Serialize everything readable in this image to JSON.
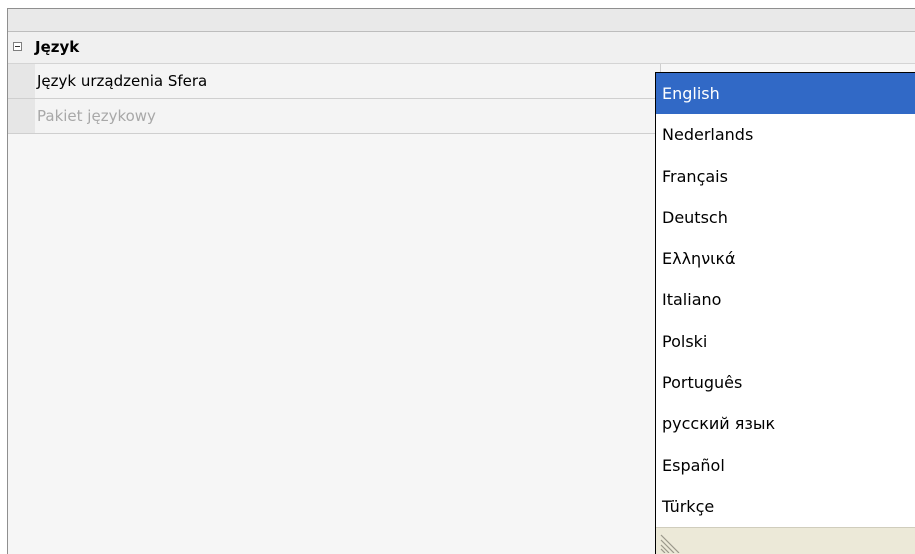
{
  "category": {
    "label": "Język",
    "expanded": true
  },
  "properties": [
    {
      "name": "Język urządzenia Sfera",
      "enabled": true
    },
    {
      "name": "Pakiet językowy",
      "enabled": false
    }
  ],
  "dropdown": {
    "selected": "English",
    "options": [
      "English",
      "Nederlands",
      "Français",
      "Deutsch",
      "Ελληνικά",
      "Italiano",
      "Polski",
      "Português",
      "русский язык",
      "Español",
      "Türkçe"
    ]
  },
  "colors": {
    "selection": "#3169c6",
    "disabled_text": "#a8a8a8",
    "grip": "#ece9d8"
  },
  "icons": {
    "collapse": "minus-box-icon",
    "resize": "resize-grip-icon"
  }
}
